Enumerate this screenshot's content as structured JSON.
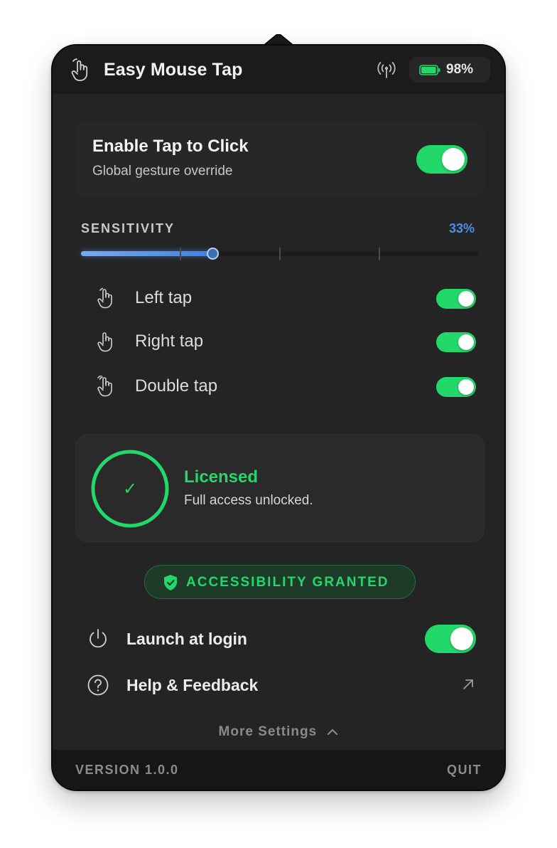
{
  "header": {
    "app_title": "Easy Mouse Tap",
    "app_icon": "hand-pointer-icon",
    "signal_icon": "antenna-signal-icon",
    "battery_icon": "battery-icon",
    "battery_text": "98%",
    "battery_level": 0.98
  },
  "enable": {
    "title": "Enable Tap to Click",
    "subtitle": "Global gesture override",
    "on": true
  },
  "sensitivity": {
    "label": "SENSITIVITY",
    "value_text": "33%",
    "value": 0.33,
    "ticks": [
      0.25,
      0.5,
      0.75
    ]
  },
  "gestures": [
    {
      "label": "Left tap",
      "icon": "tap-hand-icon",
      "on": true
    },
    {
      "label": "Right tap",
      "icon": "tap-hand-icon",
      "on": true
    },
    {
      "label": "Double tap",
      "icon": "double-tap-hand-icon",
      "on": true
    }
  ],
  "license": {
    "title": "Licensed",
    "subtitle": "Full access unlocked.",
    "check": "✓",
    "icon": "check-circle-icon"
  },
  "accessibility": {
    "label": "ACCESSIBILITY GRANTED",
    "icon": "shield-check-icon"
  },
  "settings": {
    "launch_label": "Launch at login",
    "launch_icon": "power-icon",
    "launch_on": true,
    "help_label": "Help & Feedback",
    "help_icon": "question-circle-icon",
    "help_link_icon": "external-arrow-icon"
  },
  "more_settings": "More Settings",
  "footer": {
    "version": "VERSION 1.0.0",
    "quit": "QUIT"
  },
  "colors": {
    "panel_bg": "#242424",
    "accent_green": "#22d86a",
    "accent_blue": "#4d8fe8",
    "text_primary": "#f2f2f2"
  }
}
